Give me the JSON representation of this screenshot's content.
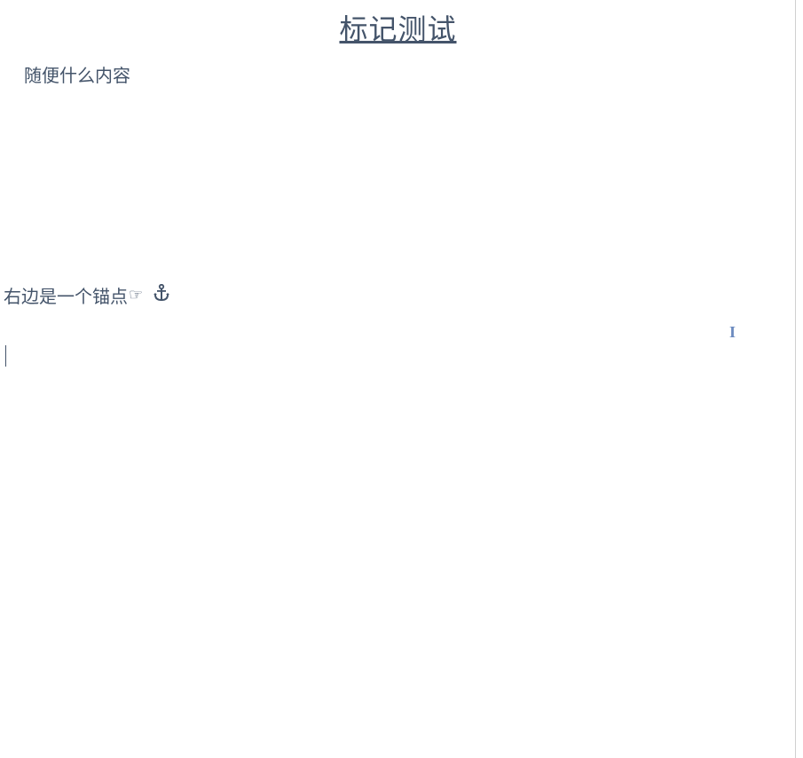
{
  "document": {
    "title": "标记测试",
    "body_text_1": "随便什么内容",
    "anchor_line_text": "右边是一个锚点",
    "pointing_hand_glyph": "☞",
    "anchor_glyph": "⚓"
  },
  "cursor": {
    "ibeam_glyph": "I"
  }
}
